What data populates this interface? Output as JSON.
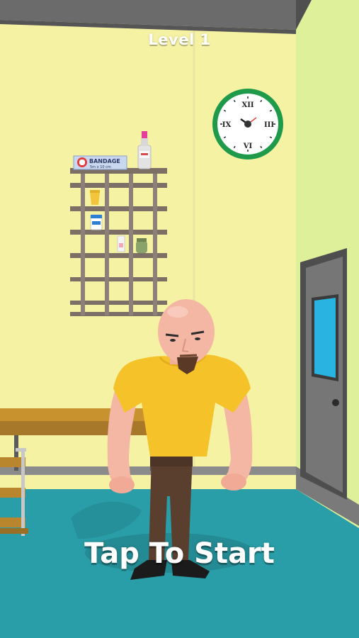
{
  "hud": {
    "level_label": "Level 1"
  },
  "start_prompt": {
    "label": "Tap To Start"
  },
  "shelf_items": {
    "bandage_label": "BANDAGE",
    "bandage_sub": "5m x 10 cm"
  },
  "clock": {
    "numeral_12": "XII",
    "numeral_3": "III",
    "numeral_6": "VI",
    "numeral_9": "IX"
  },
  "colors": {
    "wall": "#f6f2a4",
    "wall_side": "#dff09a",
    "floor": "#2a9ea8",
    "shirt": "#f6c22a",
    "skin": "#f3b7a4",
    "pants": "#5a3f2f",
    "door": "#6f6f6f",
    "clock_rim": "#1f9a4a"
  }
}
